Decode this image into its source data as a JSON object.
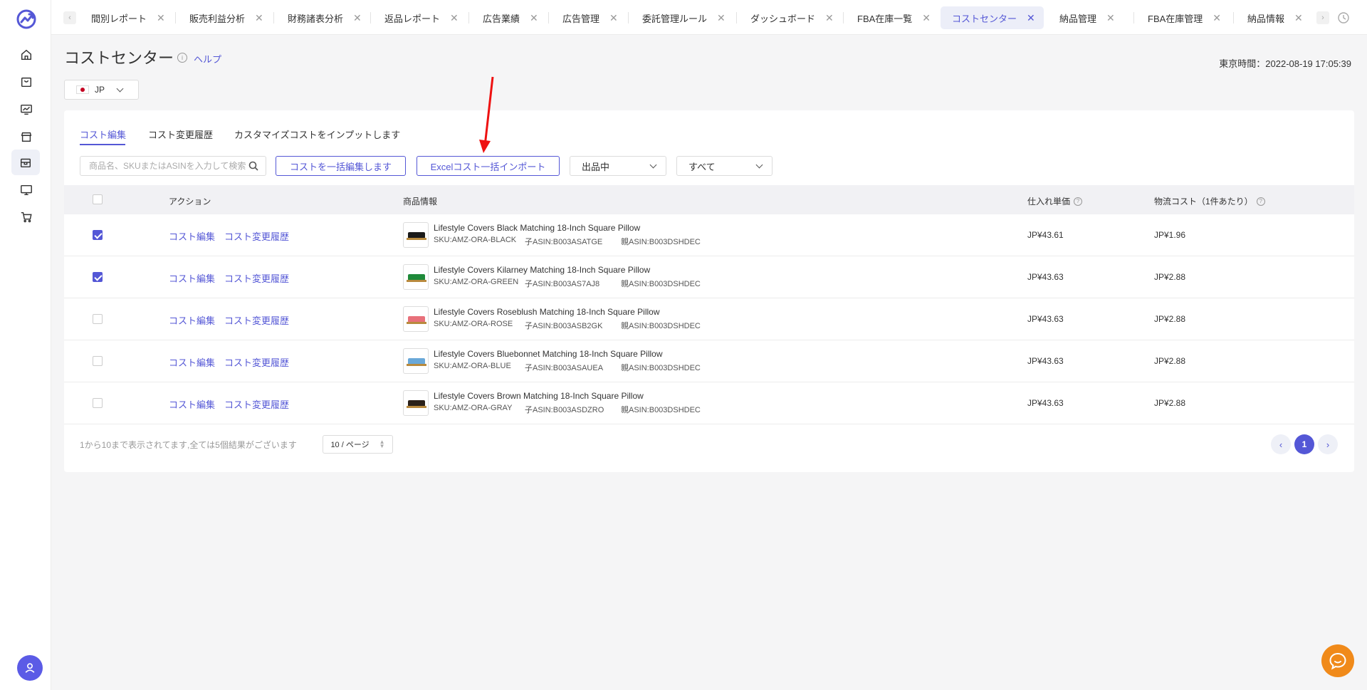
{
  "sidebar": {
    "items": [
      {
        "icon": "home-icon"
      },
      {
        "icon": "shopping-bag-icon"
      },
      {
        "icon": "chart-monitor-icon"
      },
      {
        "icon": "store-icon"
      },
      {
        "icon": "box-icon",
        "active": true
      },
      {
        "icon": "desktop-icon"
      },
      {
        "icon": "cart-icon"
      }
    ],
    "user_icon": "user-icon"
  },
  "tabs": [
    {
      "label": "間別レポート"
    },
    {
      "label": "販売利益分析"
    },
    {
      "label": "財務諸表分析"
    },
    {
      "label": "返品レポート"
    },
    {
      "label": "広告業績"
    },
    {
      "label": "広告管理"
    },
    {
      "label": "委託管理ルール"
    },
    {
      "label": "ダッシュボード"
    },
    {
      "label": "FBA在庫一覧"
    },
    {
      "label": "コストセンター",
      "active": true
    },
    {
      "label": "納品管理"
    },
    {
      "label": "FBA在庫管理"
    },
    {
      "label": "納品情報"
    }
  ],
  "tab_close": "✕",
  "tab_prev": "‹",
  "tab_next": "›",
  "header": {
    "title": "コストセンター",
    "help": "ヘルプ",
    "time_label": "東京時間：",
    "time_value": "2022-08-19 17:05:39"
  },
  "country": {
    "code": "JP"
  },
  "subtabs": [
    "コスト編集",
    "コスト変更履歴",
    "カスタマイズコストをインプットします"
  ],
  "toolbar": {
    "search_placeholder": "商品名、SKUまたはASINを入力して検索",
    "bulk_edit": "コストを一括編集します",
    "excel_import": "Excelコスト一括インポート",
    "status_filter": "出品中",
    "all_filter": "すべて"
  },
  "table": {
    "headers": {
      "action": "アクション",
      "product": "商品情報",
      "unit_price": "仕入れ単価",
      "logistics": "物流コスト（1件あたり）"
    },
    "action_edit": "コスト編集",
    "action_history": "コスト変更履歴",
    "rows": [
      {
        "checked": true,
        "name": "Lifestyle Covers Black Matching 18-Inch Square Pillow",
        "sku": "SKU:AMZ-ORA-BLACK",
        "child_asin": "子ASIN:B003ASATGE",
        "parent_asin": "親ASIN:B003DSHDEC",
        "unit_price": "JP¥43.61",
        "logistics": "JP¥1.96",
        "color": "#1a1a1a"
      },
      {
        "checked": true,
        "name": "Lifestyle Covers Kilarney Matching 18-Inch Square Pillow",
        "sku": "SKU:AMZ-ORA-GREEN",
        "child_asin": "子ASIN:B003AS7AJ8",
        "parent_asin": "親ASIN:B003DSHDEC",
        "unit_price": "JP¥43.63",
        "logistics": "JP¥2.88",
        "color": "#1e8a3a"
      },
      {
        "checked": false,
        "name": "Lifestyle Covers Roseblush Matching 18-Inch Square Pillow",
        "sku": "SKU:AMZ-ORA-ROSE",
        "child_asin": "子ASIN:B003ASB2GK",
        "parent_asin": "親ASIN:B003DSHDEC",
        "unit_price": "JP¥43.63",
        "logistics": "JP¥2.88",
        "color": "#e8707a"
      },
      {
        "checked": false,
        "name": "Lifestyle Covers Bluebonnet Matching 18-Inch Square Pillow",
        "sku": "SKU:AMZ-ORA-BLUE",
        "child_asin": "子ASIN:B003ASAUEA",
        "parent_asin": "親ASIN:B003DSHDEC",
        "unit_price": "JP¥43.63",
        "logistics": "JP¥2.88",
        "color": "#6aa8d8"
      },
      {
        "checked": false,
        "name": "Lifestyle Covers Brown Matching 18-Inch Square Pillow",
        "sku": "SKU:AMZ-ORA-GRAY",
        "child_asin": "子ASIN:B003ASDZRO",
        "parent_asin": "親ASIN:B003DSHDEC",
        "unit_price": "JP¥43.63",
        "logistics": "JP¥2.88",
        "color": "#2b2119"
      }
    ]
  },
  "pagination": {
    "summary": "1から10まで表示されてます,全ては5個結果がございます",
    "page_size": "10 / ページ",
    "current": "1"
  },
  "colors": {
    "accent": "#5457d6",
    "chat": "#f08a1a",
    "arrow": "#ee1111"
  }
}
